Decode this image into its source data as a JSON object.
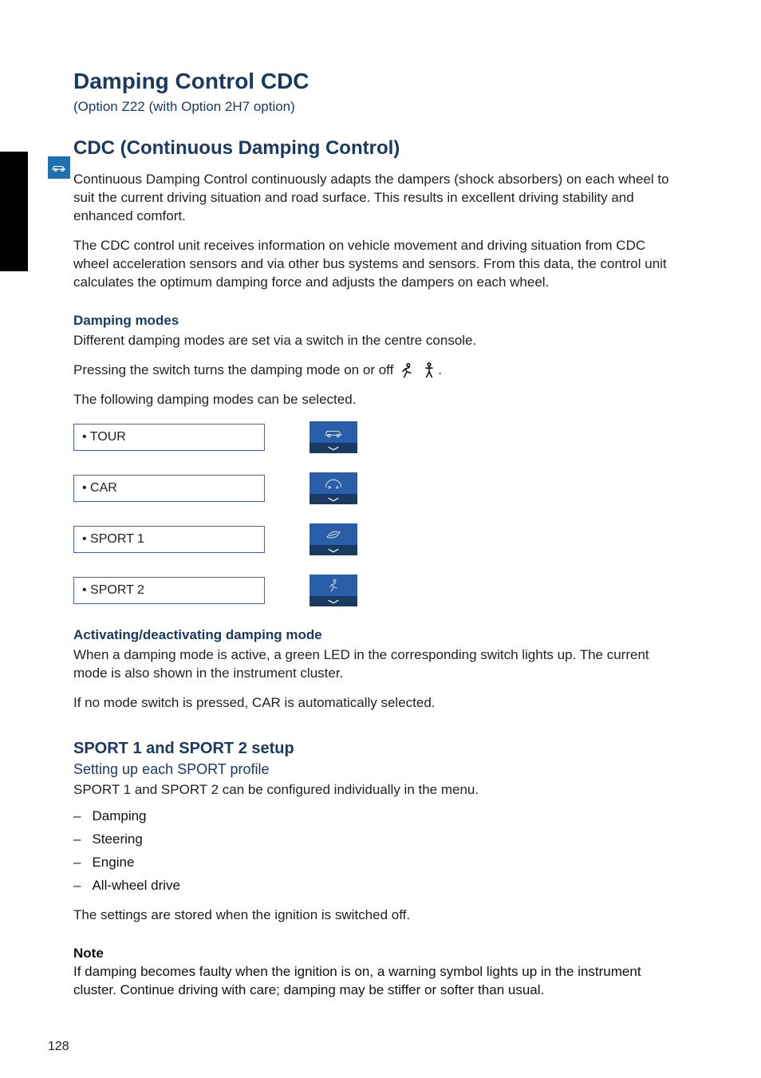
{
  "page": {
    "number": "128"
  },
  "heading": {
    "title": "Damping Control CDC",
    "subtitle": "(Option Z22 (with Option 2H7 option)"
  },
  "section": {
    "cdc_label": "CDC (Continuous Damping Control)",
    "intro": "Continuous Damping Control continuously adapts the dampers (shock absorbers) on each wheel to suit the current driving situation and road surface. This results in excellent driving stability and enhanced comfort.",
    "intro2": "The CDC control unit receives information on vehicle movement and driving situation from CDC wheel acceleration sensors and via other bus systems and sensors. From this data, the control unit calculates the optimum damping force and adjusts the dampers on each wheel.",
    "damping_modes_heading": "Damping modes",
    "damping_modes_intro": "Different damping modes are set via a switch in the centre console.",
    "modes_selected_label": "The following damping modes can be selected.",
    "modes": [
      {
        "label": "• TOUR",
        "icon": "car",
        "tile_icon": "car"
      },
      {
        "label": "• CAR",
        "icon": "car2",
        "tile_icon": "gauge"
      },
      {
        "label": "• SPORT 1",
        "icon": "sport1",
        "tile_icon": "leaf"
      },
      {
        "label": "• SPORT 2",
        "icon": "sport2",
        "tile_icon": "sport-person"
      }
    ],
    "activate_heading": "Activating/deactivating damping mode",
    "activate_text1_prefix": "Pressing the switch turns the damping mode on or off",
    "activate_text1_suffix": ".",
    "activate_text2": "When a damping mode is active, a green LED in the corresponding switch lights up. The current mode is also shown in the instrument cluster.",
    "activate_text3": "If no mode switch is pressed, CAR is automatically selected.",
    "sport_heading": "SPORT 1 and SPORT 2 setup",
    "sport_sub": "Setting up each SPORT profile",
    "sport_intro": "SPORT 1 and SPORT 2 can be configured individually in the menu.",
    "sport_bullets": [
      "Damping",
      "Steering",
      "Engine",
      "All-wheel drive"
    ],
    "sport_outro": "The settings are stored when the ignition is switched off.",
    "note_label": "Note",
    "note_text": "If damping becomes faulty when the ignition is on, a warning symbol lights up in the instrument cluster. Continue driving with care; damping may be stiffer or softer than usual."
  }
}
